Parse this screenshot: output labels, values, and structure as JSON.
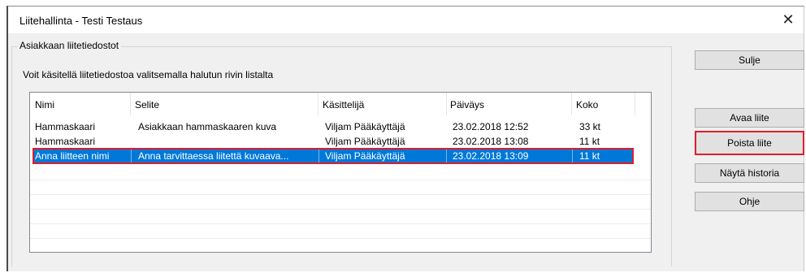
{
  "window": {
    "title": "Liitehallinta - Testi Testaus",
    "close_glyph": "✕"
  },
  "group": {
    "legend": "Asiakkaan liitetiedostot",
    "instructions": "Voit käsitellä liitetiedostoa valitsemalla halutun rivin listalta"
  },
  "table": {
    "columns": [
      "Nimi",
      "Selite",
      "Käsittelijä",
      "Päiväys",
      "Koko"
    ],
    "rows": [
      {
        "nimi": "Hammaskaari",
        "selite": "Asiakkaan hammaskaaren kuva",
        "kasittelija": "Viljam Pääkäyttäjä",
        "paivays": "23.02.2018  12:52",
        "koko": "33 kt"
      },
      {
        "nimi": "Hammaskaari",
        "selite": "",
        "kasittelija": "Viljam Pääkäyttäjä",
        "paivays": "23.02.2018  13:08",
        "koko": "11 kt"
      },
      {
        "nimi": "Anna liitteen nimi",
        "selite": "Anna tarvittaessa liitettä kuvaava...",
        "kasittelija": "Viljam Pääkäyttäjä",
        "paivays": "23.02.2018  13:09",
        "koko": "11 kt",
        "selected": true
      }
    ]
  },
  "buttons": {
    "close": "Sulje",
    "open": "Avaa liite",
    "delete": "Poista liite",
    "history": "Näytä historia",
    "help": "Ohje"
  },
  "colors": {
    "selection": "#0078d7",
    "highlight": "#e01e2b"
  }
}
